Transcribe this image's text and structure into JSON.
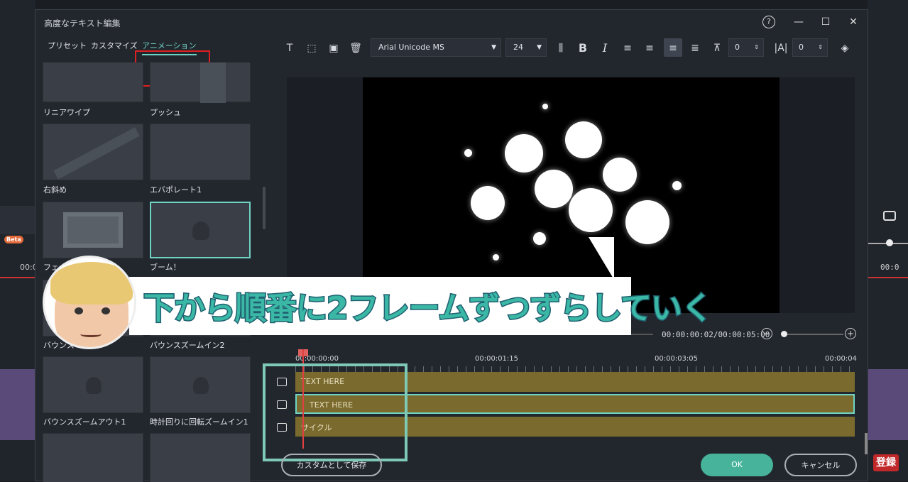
{
  "dialog": {
    "title": "高度なテキスト編集",
    "window_buttons": {
      "help": "?",
      "minimize": "—",
      "maximize": "☐",
      "close": "✕"
    }
  },
  "tabs": [
    {
      "label": "プリセット",
      "active": false
    },
    {
      "label": "カスタマイズ",
      "active": false
    },
    {
      "label": "アニメーション",
      "active": true
    }
  ],
  "animations": [
    {
      "label": "リニアワイプ"
    },
    {
      "label": "プッシュ"
    },
    {
      "label": "右斜め"
    },
    {
      "label": "エバポレート1"
    },
    {
      "label": "フェード"
    },
    {
      "label": "ブーム！",
      "selected": true
    },
    {
      "label": "バウンス"
    },
    {
      "label": "バウンスズームイン2"
    },
    {
      "label": "バウンスズームアウト1"
    },
    {
      "label": "時計回りに回転ズームイン1"
    }
  ],
  "toolbar": {
    "font": "Arial Unicode MS",
    "size": "24",
    "bold": "B",
    "italic": "I",
    "line_spacing": "0",
    "char_spacing": "0"
  },
  "playback": {
    "timecode": "00:00:00:02/00:00:05:00"
  },
  "timeline": {
    "ruler": [
      "00:00:00:00",
      "00:00:01:15",
      "00:00:03:05",
      "00:00:04"
    ],
    "tracks": [
      {
        "label": "TEXT HERE",
        "selected": false
      },
      {
        "label": "TEXT HERE",
        "selected": true
      },
      {
        "label": "サイクル",
        "selected": false
      }
    ]
  },
  "buttons": {
    "save_custom": "カスタムとして保存",
    "ok": "OK",
    "cancel": "キャンセル"
  },
  "caption": {
    "text": "下から順番に2フレームずつずらしていく"
  },
  "background": {
    "beta": "Beta",
    "left_time": "00:0",
    "right_time": "00:0",
    "subscribe": "登録"
  },
  "colors": {
    "accent": "#6fd3c3",
    "ok_button": "#46b39a",
    "track": "#7a6a2e",
    "highlight_red": "#e02020"
  }
}
